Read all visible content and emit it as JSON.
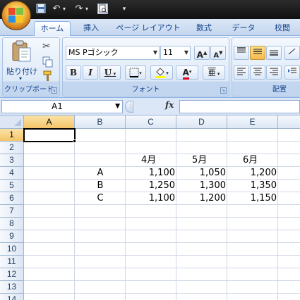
{
  "quick_access": {
    "save_icon": "save-icon",
    "undo_icon": "undo-icon",
    "redo_icon": "redo-icon",
    "preview_icon": "print-preview-icon",
    "customize_icon": "customize-qat-icon"
  },
  "tabs": [
    {
      "label": "ホーム",
      "active": true
    },
    {
      "label": "挿入"
    },
    {
      "label": "ページ レイアウト"
    },
    {
      "label": "数式"
    },
    {
      "label": "データ"
    },
    {
      "label": "校閲"
    }
  ],
  "ribbon": {
    "clipboard": {
      "paste_label": "貼り付け",
      "group_label": "クリップボード"
    },
    "font": {
      "font_name": "MS Pゴシック",
      "font_size": "11",
      "grow_label": "A",
      "shrink_label": "A",
      "bold_label": "B",
      "italic_label": "I",
      "underline_label": "U",
      "font_color_label": "A",
      "phonetic_label": "亜",
      "group_label": "フォント"
    },
    "alignment": {
      "group_label": "配置"
    }
  },
  "formula_bar": {
    "name_box": "A1",
    "fx_label": "fx",
    "formula": ""
  },
  "sheet": {
    "columns": [
      "A",
      "B",
      "C",
      "D",
      "E"
    ],
    "rows": [
      "1",
      "2",
      "3",
      "4",
      "5",
      "6",
      "7",
      "8",
      "9",
      "10",
      "11",
      "12",
      "13",
      "14"
    ],
    "active_cell": "A1",
    "headers": {
      "C": "4月",
      "D": "5月",
      "E": "6月"
    },
    "data": [
      {
        "label": "A",
        "C": "1,100",
        "D": "1,050",
        "E": "1,200"
      },
      {
        "label": "B",
        "C": "1,250",
        "D": "1,300",
        "E": "1,350"
      },
      {
        "label": "C",
        "C": "1,100",
        "D": "1,200",
        "E": "1,150"
      }
    ]
  },
  "colors": {
    "ribbon_blue": "#dce8f7",
    "header_selected": "#f5c46a",
    "gridline": "#d0d7e5"
  }
}
